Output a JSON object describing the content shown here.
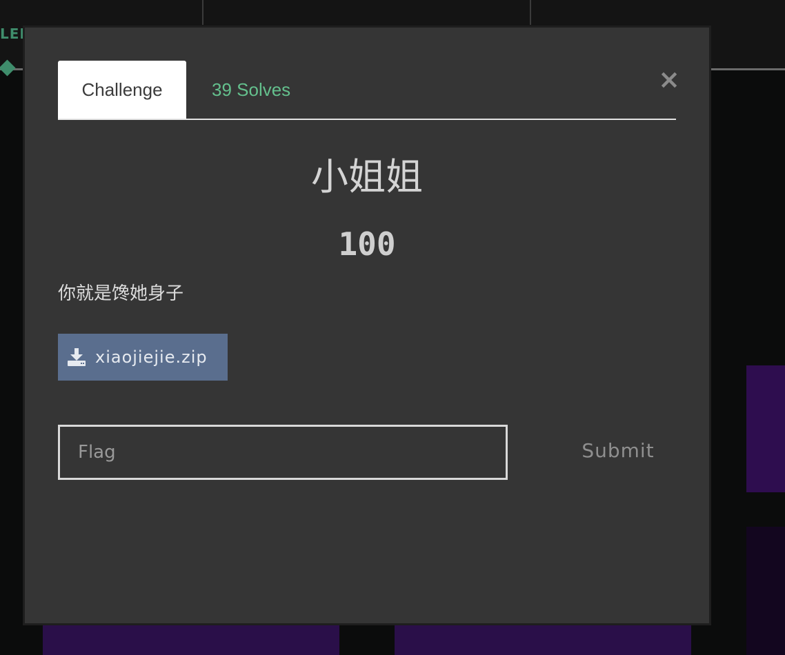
{
  "background": {
    "cut_text": "LEN"
  },
  "modal": {
    "close_glyph": "×",
    "tabs": [
      {
        "label": "Challenge",
        "active": true
      },
      {
        "label": "39 Solves",
        "active": false
      }
    ],
    "challenge": {
      "name": "小姐姐",
      "value": "100",
      "description": "你就是馋她身子"
    },
    "file": {
      "icon": "download-icon",
      "name": "xiaojiejie.zip"
    },
    "flag_input": {
      "value": "",
      "placeholder": "Flag"
    },
    "submit_label": "Submit"
  },
  "colors": {
    "modal_bg": "#353535",
    "accent_green": "#64c08d",
    "file_button": "#5a6e8e",
    "card_purple": "#2a0f49"
  }
}
